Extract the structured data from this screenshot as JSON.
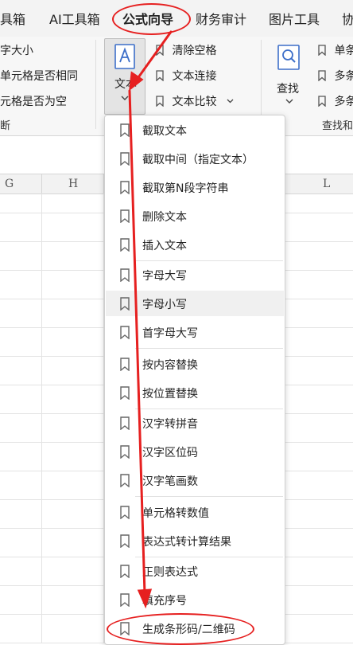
{
  "tabs": [
    {
      "label": "具箱"
    },
    {
      "label": "AI工具箱"
    },
    {
      "label": "公式向导"
    },
    {
      "label": "财务审计"
    },
    {
      "label": "图片工具"
    },
    {
      "label": "协"
    }
  ],
  "ribbon": {
    "left_items": [
      "字大小",
      "单元格是否相同",
      "元格是否为空"
    ],
    "left_group": "断",
    "text_button_label": "文本",
    "mid_items": [
      "清除空格",
      "文本连接",
      "文本比较"
    ],
    "search_label": "查找",
    "right_items": [
      "单条",
      "多条",
      "多条"
    ],
    "right_group": "查找和"
  },
  "columns": [
    "G",
    "H",
    "L"
  ],
  "menu_items": [
    {
      "label": "截取文本"
    },
    {
      "label": "截取中间（指定文本）"
    },
    {
      "label": "截取第N段字符串"
    },
    {
      "label": "删除文本"
    },
    {
      "label": "插入文本"
    },
    {
      "label": "字母大写"
    },
    {
      "label": "字母小写"
    },
    {
      "label": "首字母大写"
    },
    {
      "label": "按内容替换"
    },
    {
      "label": "按位置替换"
    },
    {
      "label": "汉字转拼音"
    },
    {
      "label": "汉字区位码"
    },
    {
      "label": "汉字笔画数"
    },
    {
      "label": "单元格转数值"
    },
    {
      "label": "表达式转计算结果"
    },
    {
      "label": "正则表达式"
    },
    {
      "label": "填充序号"
    },
    {
      "label": "生成条形码/二维码"
    }
  ],
  "colors": {
    "annotation": "#e62020",
    "accent": "#3d6fc9"
  }
}
